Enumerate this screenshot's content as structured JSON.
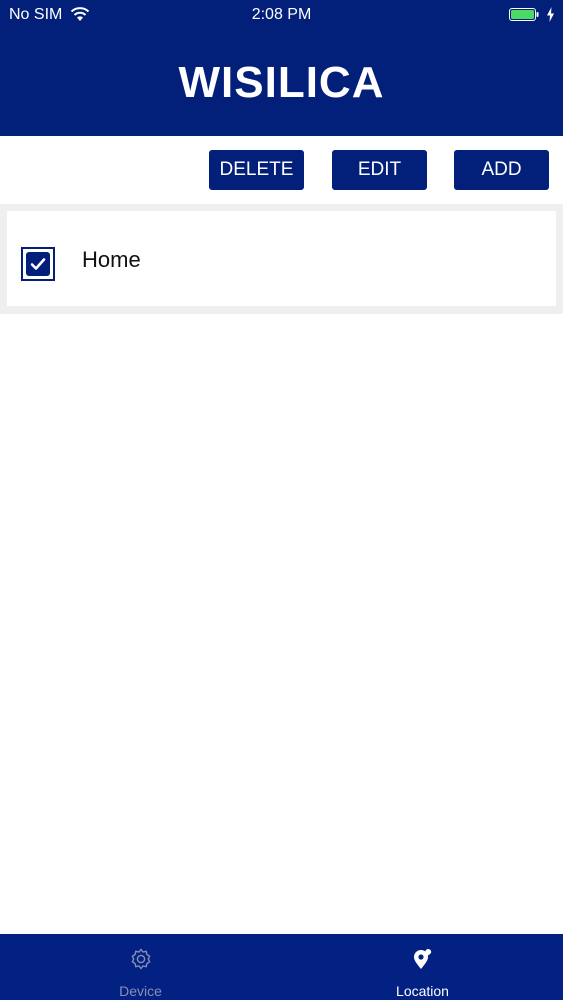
{
  "status_bar": {
    "carrier": "No SIM",
    "time": "2:08 PM",
    "battery_color": "#4cd964"
  },
  "header": {
    "logo_text": "WISILICA",
    "background": "#02207a"
  },
  "toolbar": {
    "delete_label": "DELETE",
    "edit_label": "EDIT",
    "add_label": "ADD"
  },
  "locations": [
    {
      "label": "Home",
      "checked": true
    }
  ],
  "tab_bar": {
    "tabs": [
      {
        "label": "Device",
        "icon": "gear-icon",
        "active": false
      },
      {
        "label": "Location",
        "icon": "location-pin-icon",
        "active": true
      }
    ]
  }
}
